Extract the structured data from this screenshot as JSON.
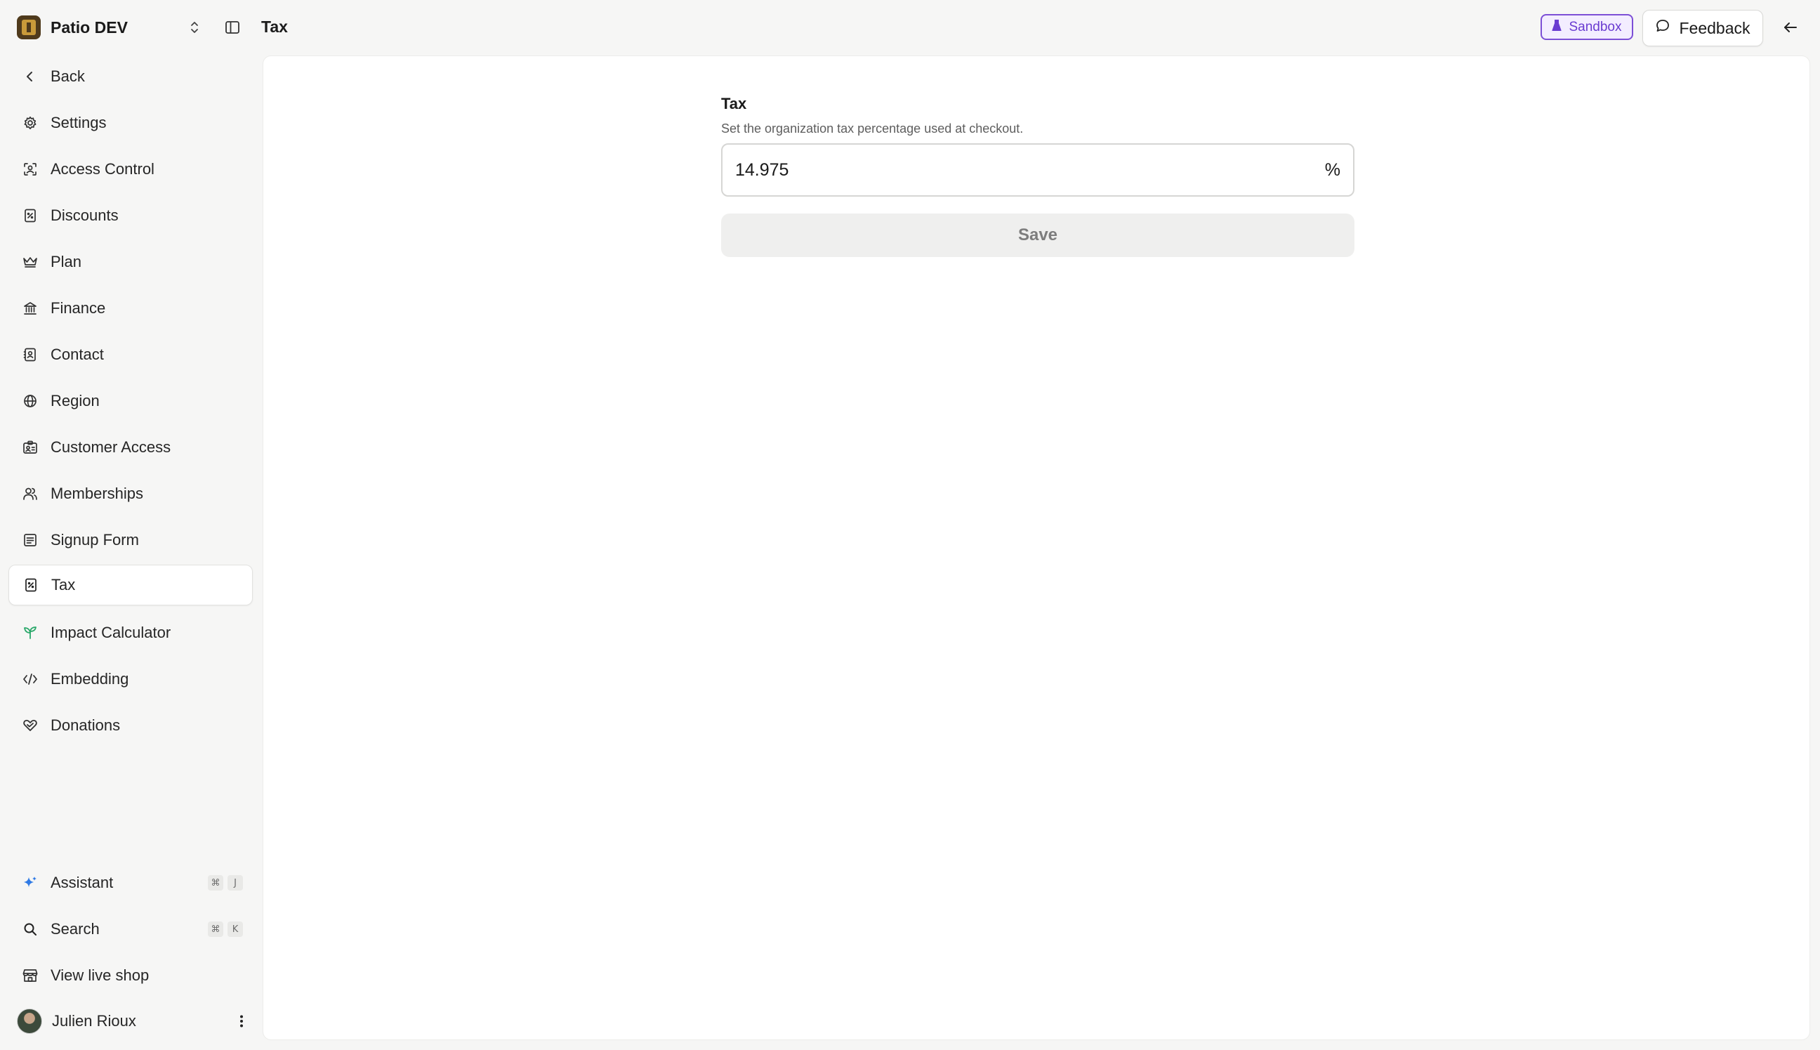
{
  "org": {
    "name": "Patio DEV"
  },
  "header": {
    "title": "Tax",
    "sandbox_label": "Sandbox",
    "feedback_label": "Feedback"
  },
  "sidebar": {
    "back_label": "Back",
    "items": [
      {
        "label": "Settings",
        "icon": "gear-icon"
      },
      {
        "label": "Access Control",
        "icon": "access-control-icon"
      },
      {
        "label": "Discounts",
        "icon": "discount-icon"
      },
      {
        "label": "Plan",
        "icon": "crown-icon"
      },
      {
        "label": "Finance",
        "icon": "bank-icon"
      },
      {
        "label": "Contact",
        "icon": "contact-book-icon"
      },
      {
        "label": "Region",
        "icon": "globe-icon"
      },
      {
        "label": "Customer Access",
        "icon": "id-card-icon"
      },
      {
        "label": "Memberships",
        "icon": "users-icon"
      },
      {
        "label": "Signup Form",
        "icon": "form-icon"
      },
      {
        "label": "Tax",
        "icon": "receipt-percent-icon",
        "active": true
      },
      {
        "label": "Impact Calculator",
        "icon": "sprout-icon"
      },
      {
        "label": "Embedding",
        "icon": "code-icon"
      },
      {
        "label": "Donations",
        "icon": "heart-hand-icon"
      }
    ],
    "bottom": [
      {
        "label": "Assistant",
        "icon": "sparkle-icon",
        "shortcut": [
          "⌘",
          "J"
        ]
      },
      {
        "label": "Search",
        "icon": "search-icon",
        "shortcut": [
          "⌘",
          "K"
        ]
      },
      {
        "label": "View live shop",
        "icon": "store-icon"
      }
    ],
    "user": {
      "name": "Julien Rioux"
    }
  },
  "form": {
    "title": "Tax",
    "description": "Set the organization tax percentage used at checkout.",
    "value": "14.975",
    "suffix": "%",
    "save_label": "Save"
  },
  "colors": {
    "accent_purple": "#6a3bd1",
    "assistant_blue": "#2f7ae5",
    "impact_green": "#2aa86a"
  }
}
